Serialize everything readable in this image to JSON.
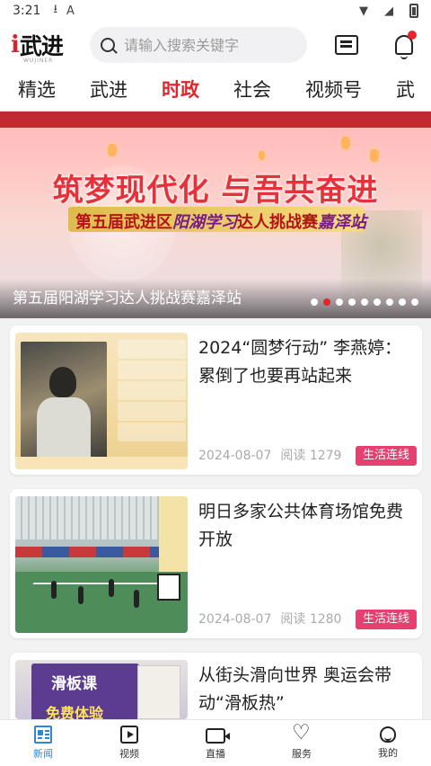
{
  "status_bar": {
    "time": "3:21",
    "icons": [
      "download-icon",
      "font-icon",
      "wifi-icon",
      "signal-icon",
      "battery-icon"
    ]
  },
  "header": {
    "logo_prefix": "i",
    "logo_name": "武进",
    "logo_sub": "WUJINER",
    "search_placeholder": "请输入搜索关键字",
    "icons": [
      "message-list-icon",
      "bell-icon"
    ]
  },
  "tabs": [
    {
      "label": "精选",
      "active": false
    },
    {
      "label": "武进",
      "active": false
    },
    {
      "label": "时政",
      "active": true
    },
    {
      "label": "社会",
      "active": false
    },
    {
      "label": "视频号",
      "active": false
    },
    {
      "label": "武",
      "active": false
    }
  ],
  "banner": {
    "headline": "筑梦现代化 与吾共奋进",
    "subhead_pre": "第五届武进区",
    "subhead_highlight": "阳湖学习",
    "subhead_post": "达人挑战赛",
    "subhead_place": "嘉泽站",
    "caption": "第五届阳湖学习达人挑战赛嘉泽站",
    "slide_count": 9,
    "active_slide": 1
  },
  "news": [
    {
      "title": "2024“圆梦行动” 李燕婷：累倒了也要再站起来",
      "date": "2024-08-07",
      "reads": "阅读 1279",
      "tag": "生活连线",
      "thumb_type": "portrait-info"
    },
    {
      "title": "明日多家公共体育场馆免费开放",
      "date": "2024-08-07",
      "reads": "阅读 1280",
      "tag": "生活连线",
      "thumb_type": "sports-hall"
    },
    {
      "title": "从街头滑向世界 奥运会带动“滑板热”",
      "date": "",
      "reads": "",
      "tag": "",
      "thumb_type": "skateboard-ad",
      "thumb_text": [
        "滑板课",
        "免费体验"
      ]
    }
  ],
  "bottom_nav": [
    {
      "label": "新闻",
      "icon": "news-icon",
      "active": true
    },
    {
      "label": "视频",
      "icon": "video-icon",
      "active": false
    },
    {
      "label": "直播",
      "icon": "live-icon",
      "active": false
    },
    {
      "label": "服务",
      "icon": "service-icon",
      "active": false
    },
    {
      "label": "我的",
      "icon": "mine-icon",
      "active": false
    }
  ],
  "colors": {
    "accent_red": "#e0262b",
    "tag_pink": "#e64071",
    "nav_active_blue": "#2f86d6"
  }
}
